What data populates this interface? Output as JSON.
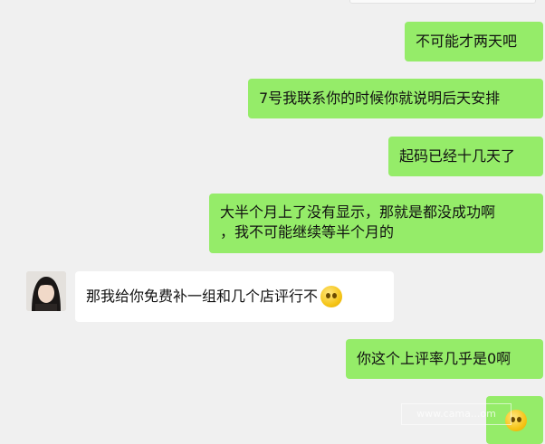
{
  "chat": {
    "messages": [
      {
        "side": "out",
        "text": "不可能才两天吧"
      },
      {
        "side": "out",
        "text": "7号我联系你的时候你就说明后天安排"
      },
      {
        "side": "out",
        "text": "起码已经十几天了"
      },
      {
        "side": "out",
        "lines": [
          "大半个月上了没有显示，那就是都没成功啊",
          "，我不可能继续等半个月的"
        ]
      },
      {
        "side": "in",
        "text": "那我给你免费补一组和几个店评行不",
        "emoji": "crying-laughing-emoji"
      },
      {
        "side": "out",
        "text": "你这个上评率几乎是0啊"
      },
      {
        "side": "out",
        "text": "",
        "emoji": "smirk-emoji"
      }
    ]
  },
  "watermark": "www.cama...om",
  "colors": {
    "outgoing": "#95ec69",
    "incoming": "#ffffff",
    "background": "#f0f0f0"
  }
}
